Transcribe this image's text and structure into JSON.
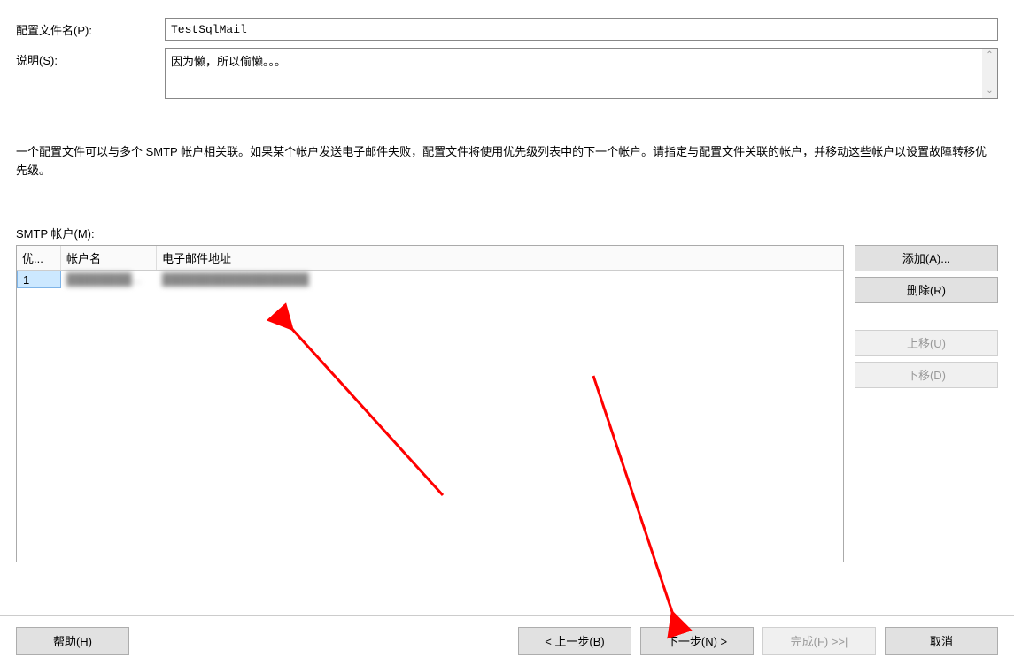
{
  "form": {
    "profileNameLabel": "配置文件名(P):",
    "profileNameValue": "TestSqlMail",
    "descriptionLabel": "说明(S):",
    "descriptionValue": "因为懒，所以偷懒。。。"
  },
  "helpText": "一个配置文件可以与多个 SMTP 帐户相关联。如果某个帐户发送电子邮件失败，配置文件将使用优先级列表中的下一个帐户。请指定与配置文件关联的帐户，并移动这些帐户以设置故障转移优先级。",
  "smtpSection": {
    "label": "SMTP 帐户(M):"
  },
  "table": {
    "headers": {
      "priority": "优...",
      "account": "帐户名",
      "email": "电子邮件地址"
    },
    "rows": [
      {
        "priority": "1",
        "account": "████████...",
        "email": "██████████████████"
      }
    ]
  },
  "sideButtons": {
    "add": "添加(A)...",
    "remove": "删除(R)",
    "moveUp": "上移(U)",
    "moveDown": "下移(D)"
  },
  "footer": {
    "help": "帮助(H)",
    "prev": "<  上一步(B)",
    "next": "下一步(N)  >",
    "finish": "完成(F)  >>|",
    "cancel": "取消"
  }
}
